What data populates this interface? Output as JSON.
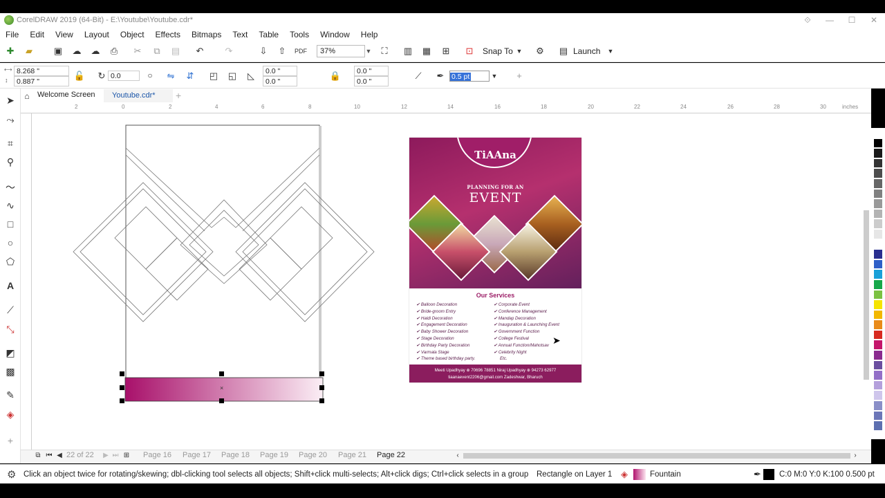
{
  "window": {
    "title": "CorelDRAW 2019 (64-Bit) - E:\\Youtube\\Youtube.cdr*",
    "controls": [
      "⟐",
      "—",
      "☐",
      "✕"
    ]
  },
  "menu": [
    "File",
    "Edit",
    "View",
    "Layout",
    "Object",
    "Effects",
    "Bitmaps",
    "Text",
    "Table",
    "Tools",
    "Window",
    "Help"
  ],
  "toolbar": {
    "zoom": "37%",
    "snap_label": "Snap To",
    "launch_label": "Launch"
  },
  "properties": {
    "width": "8.268 \"",
    "height": "0.887 \"",
    "rotation": "0.0",
    "corner_x1": "0.0 \"",
    "corner_y1": "0.0 \"",
    "corner_x2": "0.0 \"",
    "corner_y2": "0.0 \"",
    "outline_width": "0.5 pt"
  },
  "tabs": {
    "welcome": "Welcome Screen",
    "document": "Youtube.cdr*",
    "add": "+"
  },
  "ruler": {
    "unit": "inches",
    "ticks": [
      "2",
      "0",
      "2",
      "4",
      "6",
      "8",
      "10",
      "12",
      "14",
      "16",
      "18",
      "20",
      "22",
      "24",
      "26",
      "28",
      "30"
    ]
  },
  "flyer": {
    "brand": "TiAAna",
    "tagline": "PLANNING FOR AN",
    "headline": "EVENT",
    "services_title": "Our Services",
    "services_left": [
      "✔ Balloon Decoration",
      "✔ Bride-groom Entry",
      "✔ Haldi Decoration",
      "✔ Engagement Decoration",
      "✔ Baby Shower Decoration",
      "✔ Stage Decoration",
      "✔ Birthday Party Decoration",
      "✔ Varmala Stage",
      "✔ Theme based birthday party."
    ],
    "services_right": [
      "✔ Corporate Event",
      "✔ Conference Management",
      "✔ Mandap Decoration",
      "✔ Inauguration & Launching Event",
      "✔ Government Function",
      "✔ College Festival",
      "✔ Annual Function/Mahotsav",
      "✔ Celebrity Night",
      "Etc."
    ],
    "footer_line1": "Meeti Upadhyay ⊕ 70696 78851   Niraj Upadhyay ⊕ 94273 62977",
    "footer_line2": "tiaanaevent2206@gmail.com   Zadeshwar, Bharuch"
  },
  "pages": {
    "counter": "22 of 22",
    "tabs": [
      "Page 16",
      "Page 17",
      "Page 18",
      "Page 19",
      "Page 20",
      "Page 21",
      "Page 22"
    ],
    "active": "Page 22"
  },
  "status": {
    "hint": "Click an object twice for rotating/skewing; dbl-clicking tool selects all objects; Shift+click multi-selects; Alt+click digs; Ctrl+click selects in a group",
    "object": "Rectangle on Layer 1",
    "fill": "Fountain",
    "outline": "C:0 M:0 Y:0 K:100  0.500 pt"
  },
  "palette_colors": [
    "#ffffff",
    "#000000",
    "#1a1a1a",
    "#333333",
    "#4d4d4d",
    "#666666",
    "#808080",
    "#999999",
    "#b3b3b3",
    "#cccccc",
    "#e6e6e6",
    "#ffffff",
    "#2a2f8f",
    "#2e5fc7",
    "#1aa0d8",
    "#16a84a",
    "#7cc142",
    "#f5e400",
    "#f2b800",
    "#e98b1a",
    "#d82a20",
    "#c4166b",
    "#8a2b8f",
    "#6b4fa0",
    "#9370c8",
    "#b4a0dc",
    "#cfc6ec",
    "#8a8fc8",
    "#6c76b8",
    "#5d6fb0"
  ],
  "accent": "#b0146e"
}
